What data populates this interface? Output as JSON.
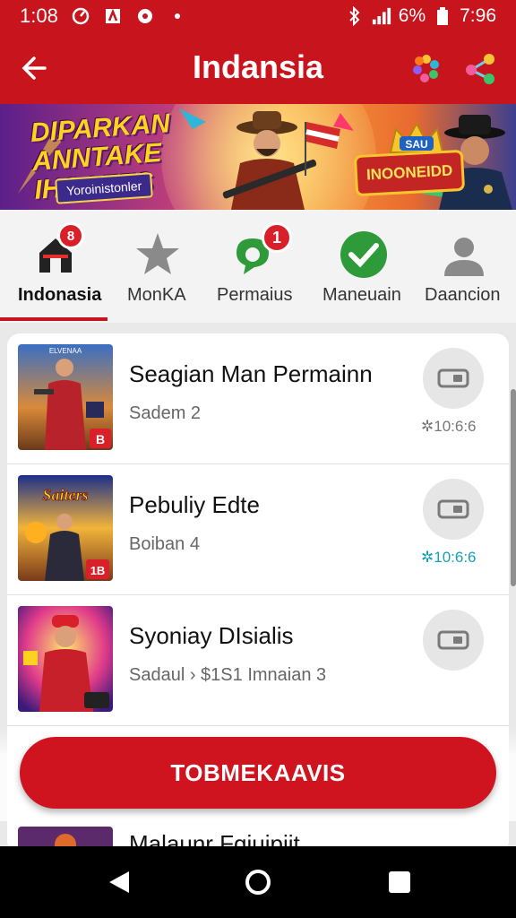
{
  "status_bar": {
    "time_left": "1:08",
    "battery": "6%",
    "clock": "7:96",
    "icons": [
      "speed-icon",
      "app-icon",
      "circle-icon",
      "dot-icon",
      "bluetooth-icon",
      "signal-icon",
      "battery-icon"
    ]
  },
  "app_bar": {
    "title": "Indansia",
    "back_icon": "arrow-left-icon",
    "actions": [
      "colorful-dots-icon",
      "share-icon"
    ]
  },
  "banner": {
    "heading_line1": "DIPARKAN",
    "heading_line2": "ANNTAKE IHGAETS",
    "chip": "Yoroinistonler",
    "badge_top": "SAU",
    "badge_main": "INOONEIDD"
  },
  "tabs": [
    {
      "label": "Indonasia",
      "badge": "8",
      "icon": "home-icon",
      "active": true
    },
    {
      "label": "MonKA",
      "badge": "",
      "icon": "star-icon",
      "active": false
    },
    {
      "label": "Permaius",
      "badge": "1",
      "icon": "chat-icon",
      "active": false
    },
    {
      "label": "Maneuain",
      "badge": "",
      "icon": "check-icon",
      "active": false
    },
    {
      "label": "Daancion",
      "badge": "",
      "icon": "user-icon",
      "active": false
    }
  ],
  "items": [
    {
      "title": "Seagian Man Permainn",
      "subtitle": "Sadem 2",
      "time": "✲10:6:6",
      "thumb_label": "B",
      "thumb_caption": "ELVENAA"
    },
    {
      "title": "Pebuliy Edte",
      "subtitle": "Boiban 4",
      "time": "✲10:6:6",
      "thumb_label": "1B",
      "thumb_caption": "Saiters"
    },
    {
      "title": "Syoniay DIsialis",
      "subtitle": "Sadaul › $1S1 Imnaian 3",
      "time": "",
      "thumb_label": "",
      "thumb_caption": ""
    },
    {
      "title": "Malaunr Fqiuipiit",
      "subtitle": "",
      "time": "",
      "thumb_label": "",
      "thumb_caption": ""
    }
  ],
  "cta": {
    "label": "TOBMEKAAVIS"
  },
  "nav": [
    "back-triangle-icon",
    "home-circle-icon",
    "recents-square-icon"
  ],
  "colors": {
    "primary": "#c8141d",
    "accent_teal": "#15a0b8",
    "tab_bg": "#f3f3f3"
  }
}
